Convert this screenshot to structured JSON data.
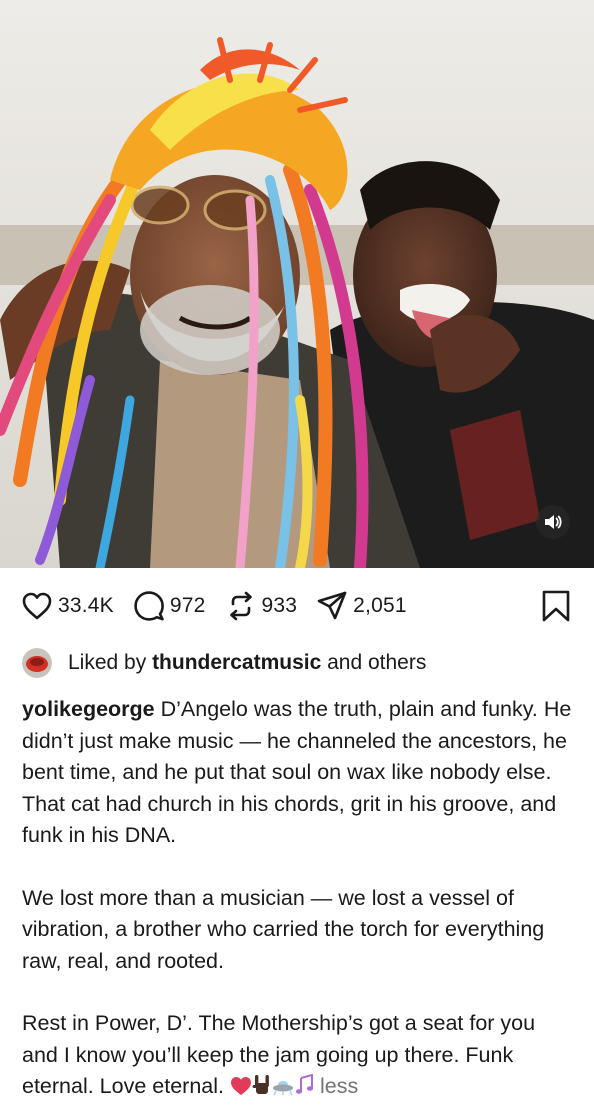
{
  "post": {
    "media": {
      "alt": "",
      "mute_icon": "speaker-icon"
    },
    "actions": {
      "likes": "33.4K",
      "comments": "972",
      "reposts": "933",
      "shares": "2,051"
    },
    "liked_by": {
      "prefix": "Liked by",
      "user": "thundercatmusic",
      "suffix": "and others"
    },
    "caption": {
      "username": "yolikegeorge",
      "paragraph1": "D’Angelo was the truth, plain and funky. He didn’t just make music — he channeled the ancestors, he bent time, and he put that soul on wax like nobody else. That cat had church in his chords, grit in his groove, and funk in his DNA.",
      "paragraph2": "We lost more than a musician — we lost a vessel of vibration, a brother who carried the torch for everything raw, real, and rooted.",
      "paragraph3": "Rest in Power, D’. The Mothership’s got a seat for you and I know you’ll keep the jam going up there. Funk eternal. Love eternal.",
      "less_label": "less"
    }
  },
  "colors": {
    "text": "#1a1a1a",
    "muted": "#737373",
    "heart": "#e23b5a"
  }
}
